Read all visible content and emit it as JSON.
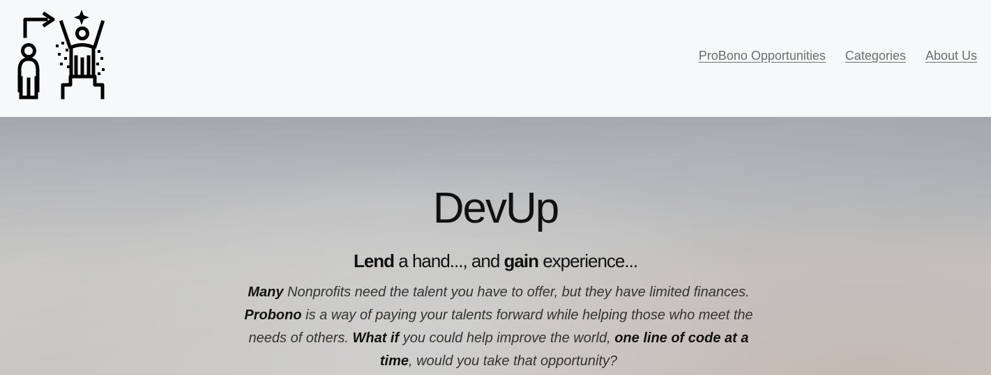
{
  "header": {
    "logo_icon": "person-celebrating-icon",
    "nav": [
      {
        "label": "ProBono Opportunities"
      },
      {
        "label": "Categories"
      },
      {
        "label": "About Us"
      }
    ]
  },
  "hero": {
    "title": "DevUp",
    "tagline": {
      "w1": "Lend",
      "w2": " a hand..., and ",
      "w3": "gain",
      "w4": " experience..."
    },
    "body": {
      "s1": "Many",
      "s2": " Nonprofits need the talent you have to offer, but they have limited finances. ",
      "s3": "Probono",
      "s4": " is a way of paying your talents forward while helping those who meet the needs of others. ",
      "s5": "What if",
      "s6": " you could help improve the world, ",
      "s7": "one line of code at a time",
      "s8": ", would you take that opportunity?"
    }
  }
}
